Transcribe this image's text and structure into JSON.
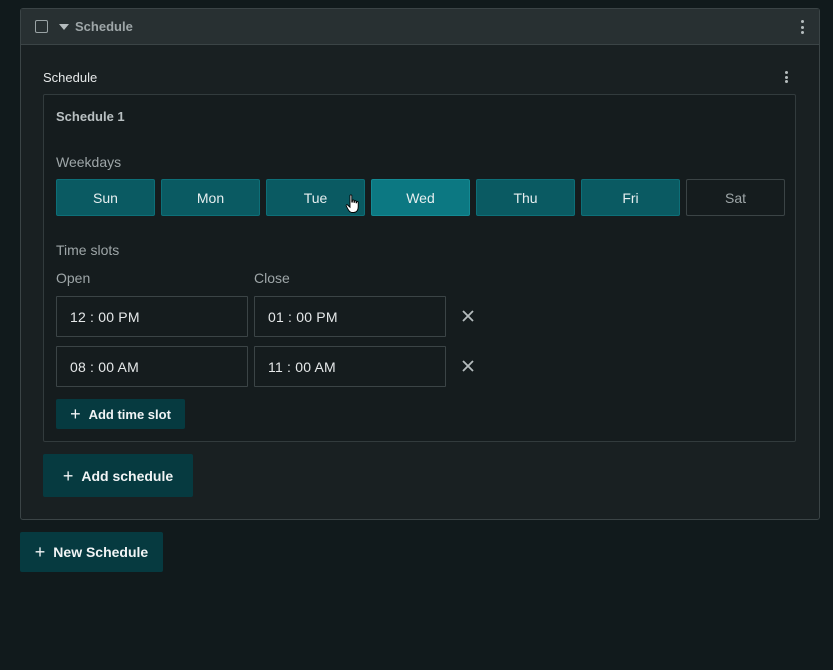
{
  "panel": {
    "title": "Schedule"
  },
  "section": {
    "title": "Schedule"
  },
  "schedule": {
    "title": "Schedule 1",
    "weekdays_label": "Weekdays",
    "days": [
      {
        "label": "Sun",
        "selected": true
      },
      {
        "label": "Mon",
        "selected": true
      },
      {
        "label": "Tue",
        "selected": true
      },
      {
        "label": "Wed",
        "selected": true
      },
      {
        "label": "Thu",
        "selected": true
      },
      {
        "label": "Fri",
        "selected": true
      },
      {
        "label": "Sat",
        "selected": false
      }
    ],
    "time_slots_label": "Time slots",
    "open_label": "Open",
    "close_label": "Close",
    "slots": [
      {
        "open": "12 : 00  PM",
        "close": "01 : 00  PM"
      },
      {
        "open": "08 : 00  AM",
        "close": "11 : 00  AM"
      }
    ],
    "add_time_slot_label": "Add time slot"
  },
  "add_schedule_label": "Add schedule",
  "new_schedule_label": "New Schedule",
  "icons": {
    "remove": "close-icon",
    "add": "plus-icon",
    "menu": "kebab-icon",
    "collapse": "caret-down-icon"
  },
  "colors": {
    "accent": "#0a5a62",
    "accent_hover": "#0c7882",
    "button": "#063a40",
    "background": "#111a1c"
  }
}
